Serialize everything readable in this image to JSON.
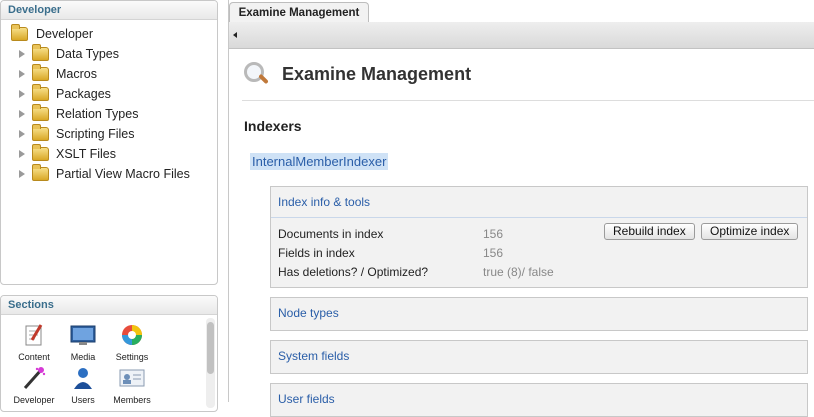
{
  "tree": {
    "header": "Developer",
    "root": "Developer",
    "items": [
      {
        "label": "Data Types"
      },
      {
        "label": "Macros"
      },
      {
        "label": "Packages"
      },
      {
        "label": "Relation Types"
      },
      {
        "label": "Scripting Files"
      },
      {
        "label": "XSLT Files"
      },
      {
        "label": "Partial View Macro Files"
      }
    ]
  },
  "sections": {
    "header": "Sections",
    "items": [
      {
        "label": "Content",
        "icon": "content-icon"
      },
      {
        "label": "Media",
        "icon": "media-icon"
      },
      {
        "label": "Settings",
        "icon": "settings-icon"
      },
      {
        "label": "Developer",
        "icon": "developer-icon"
      },
      {
        "label": "Users",
        "icon": "users-icon"
      },
      {
        "label": "Members",
        "icon": "members-icon"
      }
    ]
  },
  "tab": {
    "label": "Examine Management"
  },
  "main": {
    "title": "Examine Management",
    "indexers_heading": "Indexers",
    "indexer_name": "InternalMemberIndexer",
    "info_box": {
      "title": "Index info & tools",
      "rows": [
        {
          "label": "Documents in index",
          "value": "156"
        },
        {
          "label": "Fields in index",
          "value": "156"
        },
        {
          "label": "Has deletions? / Optimized?",
          "value": "true (8)/ false"
        }
      ],
      "rebuild_label": "Rebuild index",
      "optimize_label": "Optimize index"
    },
    "node_types": "Node types",
    "system_fields": "System fields",
    "user_fields": "User fields"
  },
  "colors": {
    "link": "#2a5ea8",
    "section_header": "#3a6e8c",
    "highlight": "#cfe2f6"
  }
}
